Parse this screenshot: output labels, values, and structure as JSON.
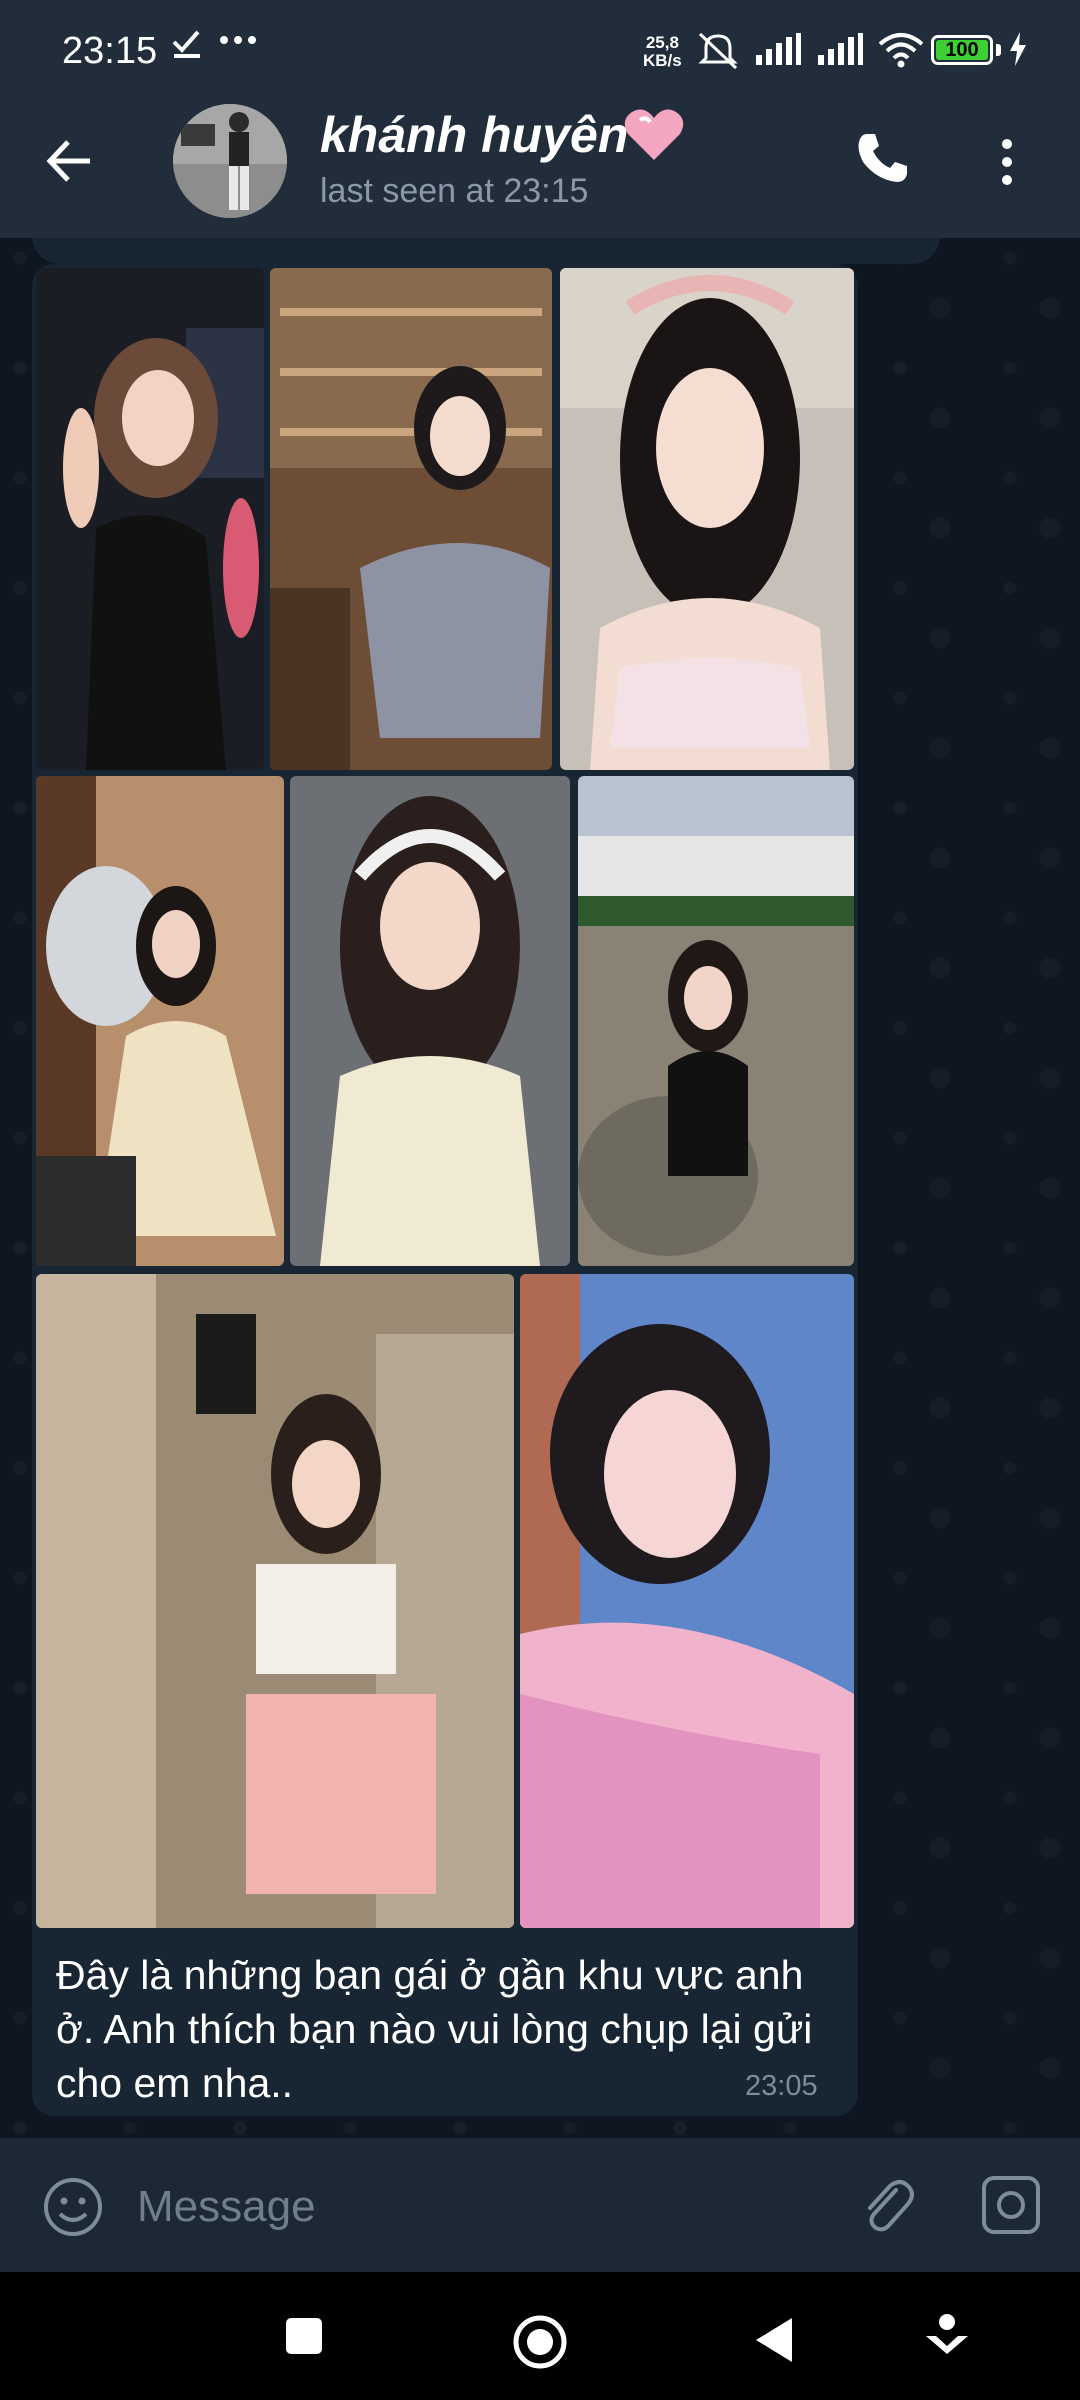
{
  "status_bar": {
    "time": "23:15",
    "net_speed_value": "25,8",
    "net_speed_unit": "KB/s",
    "battery_level": "100"
  },
  "header": {
    "contact_name": "khánh huyên",
    "last_seen": "last seen at 23:15"
  },
  "message": {
    "photo_count": 8,
    "caption": "Đây là những bạn gái ở gần khu vực anh ở. Anh thích bạn nào vui lòng chụp lại gửi cho em nha..",
    "time": "23:05"
  },
  "input": {
    "placeholder": "Message"
  },
  "colors": {
    "header_bg": "#212d3b",
    "chat_bg": "#0e1621",
    "bubble_bg": "#182533",
    "accent_heart": "#f4a6c1",
    "battery": "#3ecf35"
  }
}
